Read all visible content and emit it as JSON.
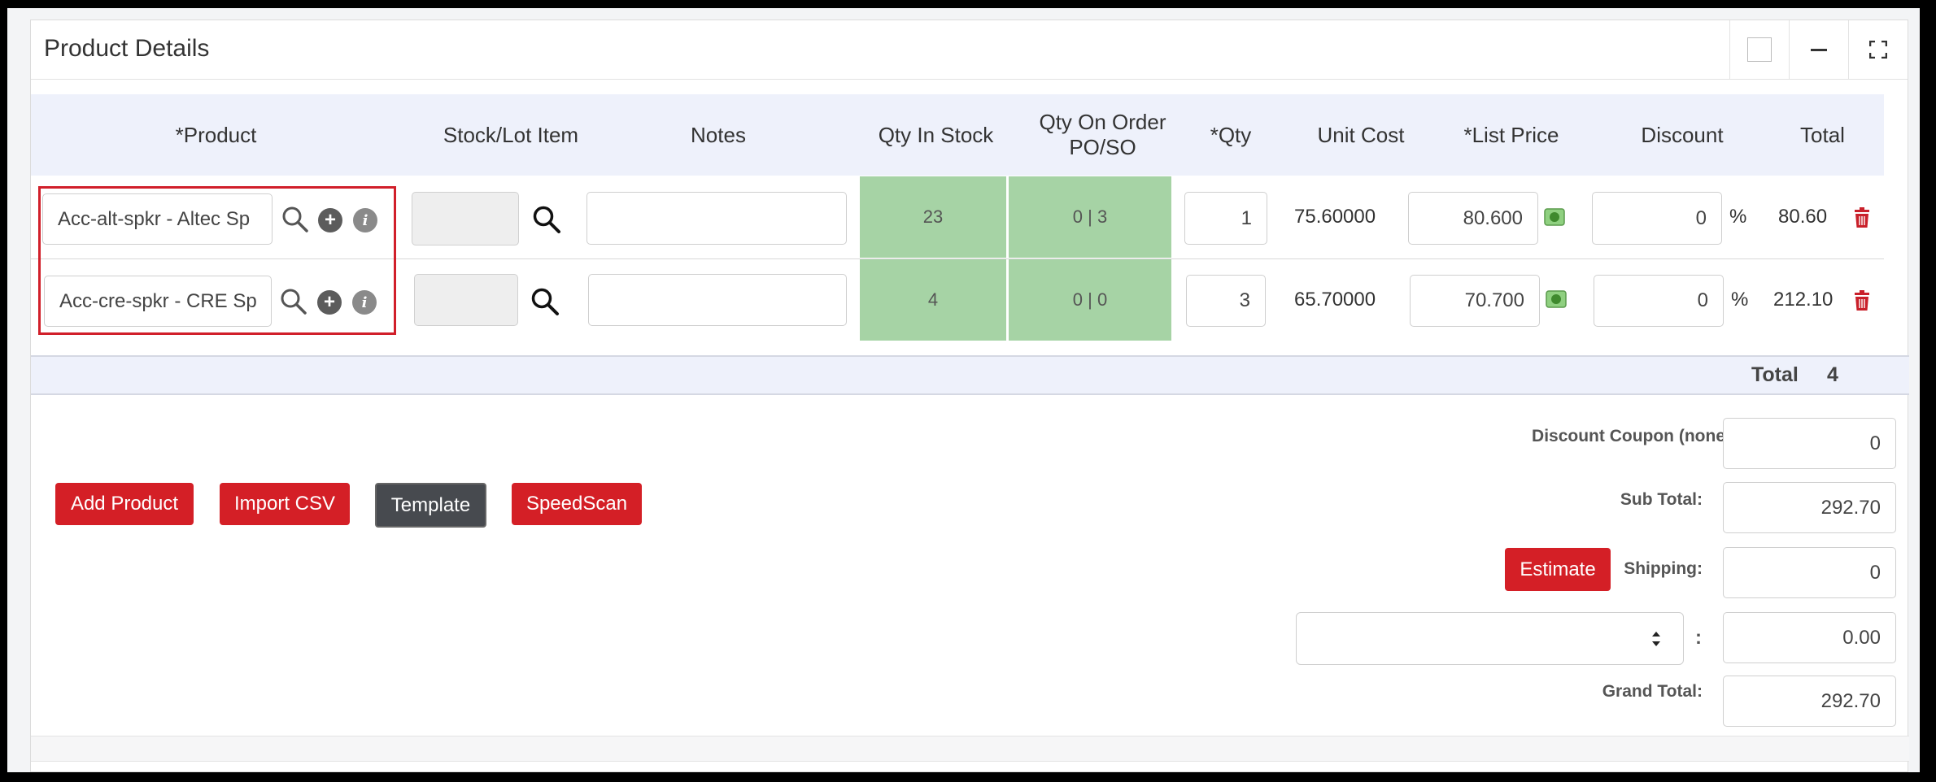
{
  "panel": {
    "title": "Product Details"
  },
  "columns": {
    "product": "*Product",
    "stock_lot": "Stock/Lot Item",
    "notes": "Notes",
    "qty_in_stock": "Qty In Stock",
    "qty_on_order": "Qty On Order PO/SO",
    "qty": "*Qty",
    "unit_cost": "Unit Cost",
    "list_price": "*List Price",
    "discount": "Discount",
    "total": "Total"
  },
  "rows": [
    {
      "product": "Acc-alt-spkr - Altec Sp",
      "stock_lot": "",
      "notes": "",
      "qty_in_stock": "23",
      "qty_on_order": "0 | 3",
      "qty": "1",
      "unit_cost": "75.60000",
      "list_price": "80.600",
      "discount": "0",
      "discount_unit": "%",
      "total": "80.60"
    },
    {
      "product": "Acc-cre-spkr - CRE Sp",
      "stock_lot": "",
      "notes": "",
      "qty_in_stock": "4",
      "qty_on_order": "0 | 0",
      "qty": "3",
      "unit_cost": "65.70000",
      "list_price": "70.700",
      "discount": "0",
      "discount_unit": "%",
      "total": "212.10"
    }
  ],
  "totals_bar": {
    "label": "Total",
    "value": "4"
  },
  "actions": {
    "add_product": "Add Product",
    "import_csv": "Import CSV",
    "template": "Template",
    "speedscan": "SpeedScan"
  },
  "summary": {
    "discount_coupon_label": "Discount Coupon (none)",
    "discount_coupon_value": "0",
    "sub_total_label": "Sub Total:",
    "sub_total_value": "292.70",
    "estimate_button": "Estimate",
    "shipping_label": "Shipping:",
    "shipping_value": "0",
    "tax_separator": ":",
    "tax_value": "0.00",
    "grand_total_label": "Grand Total:",
    "grand_total_value": "292.70"
  },
  "colors": {
    "accent_red": "#d41f26",
    "stock_green": "#a6d3a5",
    "header_bg": "#eef1fb",
    "dark_button": "#474a4f"
  }
}
